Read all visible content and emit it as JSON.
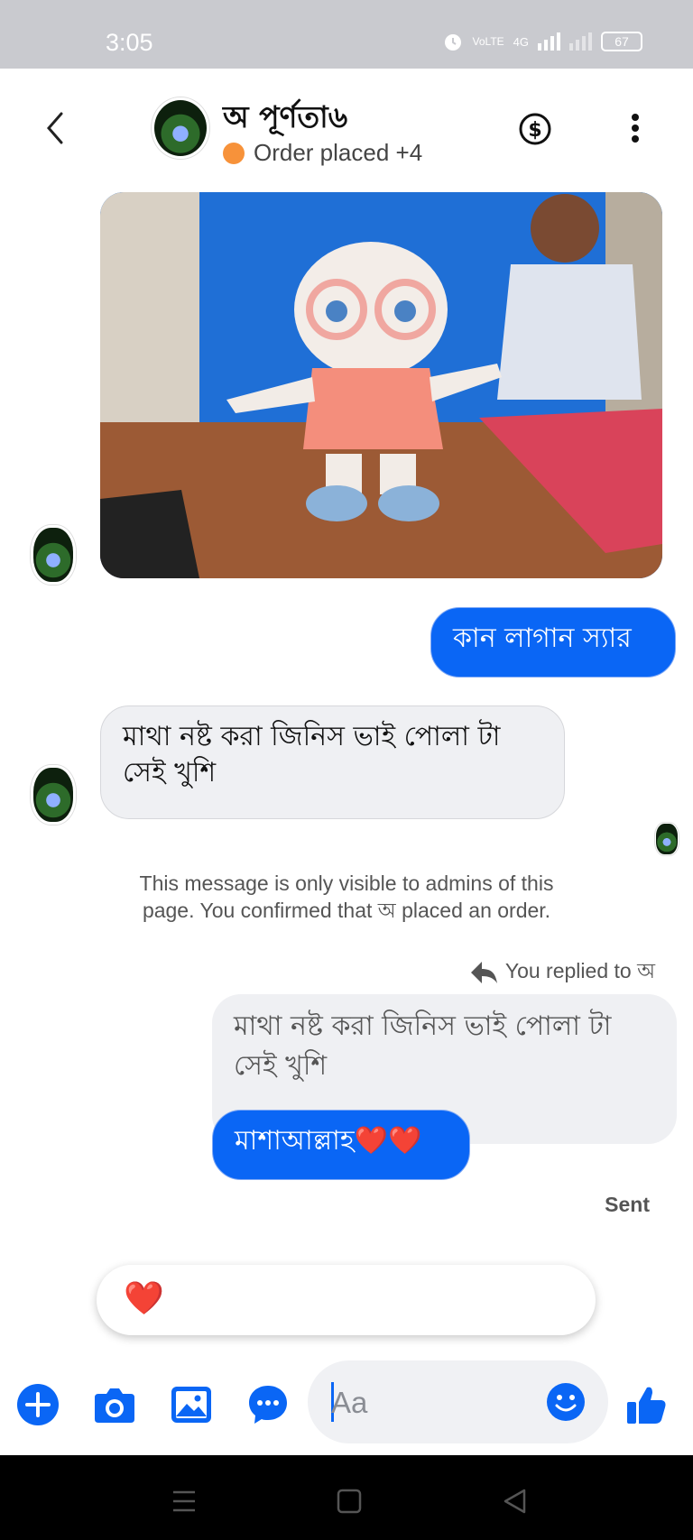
{
  "status_bar": {
    "time": "3:05",
    "network_label": "VoLTE",
    "signal_label": "4G",
    "battery": "67"
  },
  "header": {
    "name": "অ পূর্ণতা৬",
    "status_text": "Order placed +4"
  },
  "messages": {
    "outgoing_1": "কান লাগান স্যার",
    "incoming_1_line1": "মাথা নষ্ট করা জিনিস ভাই পোলা টা",
    "incoming_1_line2": "সেই খুশি",
    "admin_note_line1": "This message is only visible to admins of this",
    "admin_note_line2": "page. You confirmed that অ placed an order.",
    "reply_hint": "You replied to অ",
    "quoted_line1": "মাথা নষ্ট করা জিনিস ভাই পোলা টা",
    "quoted_line2": "সেই খুশি",
    "reply_text": "মাশাআল্লাহ",
    "reply_emoji": "❤️❤️",
    "sent_label": "Sent",
    "reaction_emoji": "❤️"
  },
  "composer": {
    "placeholder": "Aa"
  },
  "colors": {
    "accent": "#0a66f5",
    "order_dot": "#f7923a"
  }
}
